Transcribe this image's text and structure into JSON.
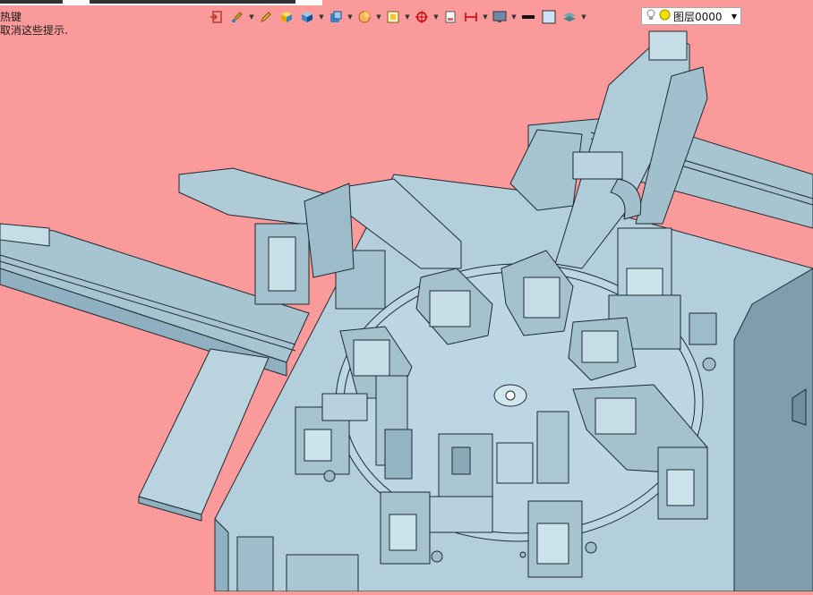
{
  "window": {
    "title": ""
  },
  "hints": {
    "line1": "热键",
    "line2": "取消这些提示."
  },
  "toolbar": {
    "items": [
      {
        "icon": "exit-sketch-icon"
      },
      {
        "icon": "paint-brush-icon",
        "dropdown": true
      },
      {
        "icon": "pencil-icon"
      },
      {
        "icon": "box-shaded-icon"
      },
      {
        "icon": "cube-view-icon",
        "dropdown": true
      },
      {
        "icon": "cube-display-icon",
        "dropdown": true
      },
      {
        "icon": "pie-section-icon",
        "dropdown": true
      },
      {
        "icon": "zoom-fit-icon",
        "dropdown": true
      },
      {
        "icon": "crosshair-icon",
        "dropdown": true
      },
      {
        "icon": "sheet-icon"
      },
      {
        "icon": "dimension-icon",
        "dropdown": true
      },
      {
        "icon": "monitor-icon",
        "dropdown": true
      },
      {
        "icon": "line-black-icon"
      },
      {
        "icon": "color-swatch-icon"
      },
      {
        "icon": "layers-icon",
        "dropdown": true
      }
    ]
  },
  "layer_select": {
    "value": "图层0000",
    "icons": [
      "lightbulb-icon",
      "sun-icon"
    ]
  },
  "colors": {
    "background": "#fa9a9a",
    "model_fill": "#b7d3df",
    "model_stroke": "#1f2a30"
  }
}
